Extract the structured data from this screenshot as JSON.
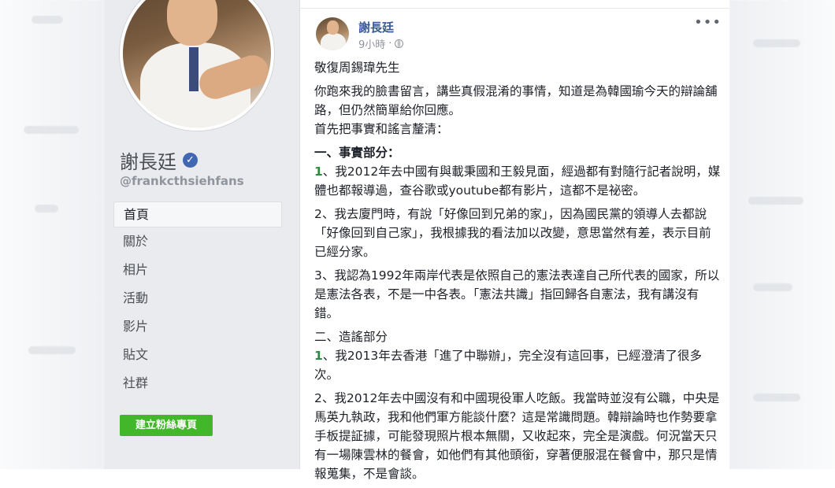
{
  "page": {
    "name": "謝長廷",
    "handle": "@frankcthsiehfans",
    "nav": [
      "首頁",
      "關於",
      "相片",
      "活動",
      "影片",
      "貼文",
      "社群"
    ],
    "create_button": "建立粉絲專頁"
  },
  "post": {
    "author": "謝長廷",
    "time": "9小時",
    "time_sep": "·",
    "more": "•••",
    "paragraphs": [
      "敬復周錫瑋先生",
      "你跑來我的臉書留言，講些真假混淆的事情，知道是為韓國瑜今天的辯論舖路，但仍然簡單給你回應。\n首先把事實和謠言釐清：",
      "一、事實部分：",
      "、我2012年去中國有與載秉國和王毅見面，經過都有對隨行記者說明，媒體也都報導過，查谷歌或youtube都有影片，這都不是祕密。",
      "2、我去廈門時，有說「好像回到兄弟的家」，因為國民黨的領導人去都說「好像回到自己家」，我根據我的看法加以改變，意思當然有差，表示目前已經分家。",
      "3、我認為1992年兩岸代表是依照自己的憲法表達自己所代表的國家，所以是憲法各表，不是一中各表。「憲法共識」指回歸各自憲法，我有講沒有錯。",
      "二、造謠部分",
      "、我2013年去香港「進了中聯辦」，完全沒有這回事，已經澄清了很多次。",
      "2、我2012年去中國沒有和中國現役軍人吃飯。我當時並沒有公職，中央是馬英九執政，我和他們軍方能談什麼？這是常識問題。韓辯論時也作勢要拿手板提証據，可能發現照片根本無關，又收起來，完全是演戲。何況當天只有一場陳雲林的餐會，如他們有其他頭銜，穿著便服混在餐會中，那只是情報蒐集，不是會談。"
    ],
    "numbered_prefix": "1"
  },
  "colors": {
    "link": "#385898",
    "verified": "#4267b2",
    "create_button": "#42b72a",
    "background": "#e9ebee"
  },
  "icons": {
    "verified": "check-badge-icon",
    "privacy": "globe-icon",
    "more": "more-icon"
  }
}
